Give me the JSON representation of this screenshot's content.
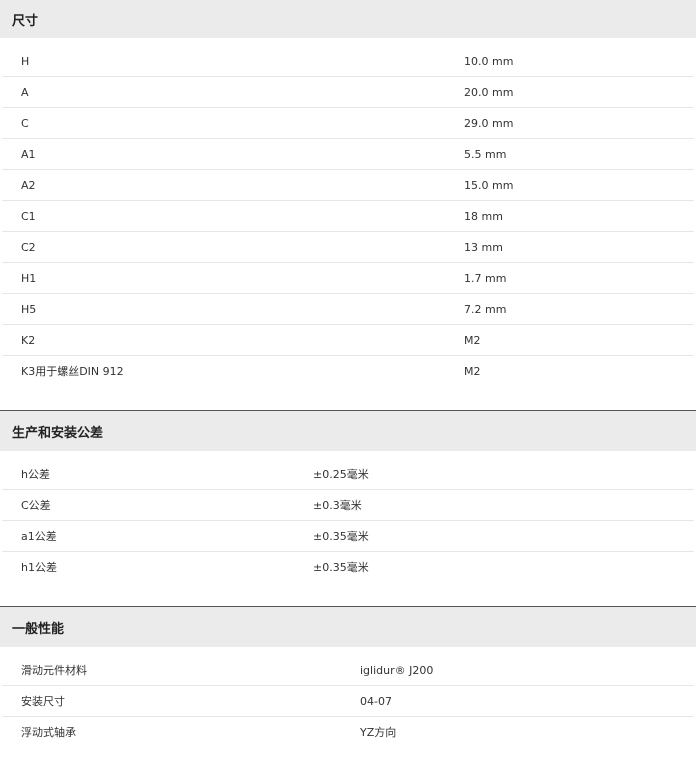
{
  "sections": [
    {
      "title": "尺寸",
      "rows": [
        {
          "key": "H",
          "value": "10.0 mm"
        },
        {
          "key": "A",
          "value": "20.0 mm"
        },
        {
          "key": "C",
          "value": "29.0 mm"
        },
        {
          "key": "A1",
          "value": "5.5 mm"
        },
        {
          "key": "A2",
          "value": "15.0 mm"
        },
        {
          "key": "C1",
          "value": "18 mm"
        },
        {
          "key": "C2",
          "value": "13 mm"
        },
        {
          "key": "H1",
          "value": "1.7 mm"
        },
        {
          "key": "H5",
          "value": "7.2 mm"
        },
        {
          "key": "K2",
          "value": "M2"
        },
        {
          "key": "K3用于螺丝DIN 912",
          "value": "M2"
        }
      ]
    },
    {
      "title": "生产和安装公差",
      "rows": [
        {
          "key": "h公差",
          "value": "±0.25毫米"
        },
        {
          "key": "C公差",
          "value": "±0.3毫米"
        },
        {
          "key": "a1公差",
          "value": "±0.35毫米"
        },
        {
          "key": "h1公差",
          "value": "±0.35毫米"
        }
      ]
    },
    {
      "title": "一般性能",
      "rows": [
        {
          "key": "滑动元件材料",
          "value": "iglidur® J200"
        },
        {
          "key": "安装尺寸",
          "value": "04-07"
        },
        {
          "key": "浮动式轴承",
          "value": "YZ方向"
        }
      ]
    }
  ]
}
